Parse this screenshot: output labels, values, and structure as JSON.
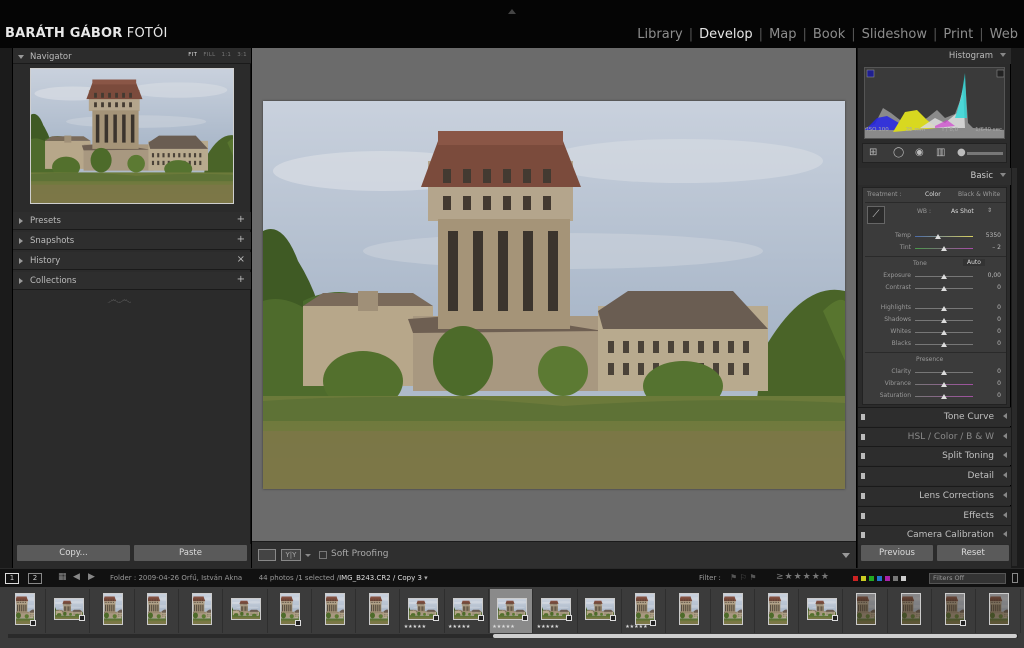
{
  "brand": {
    "bold": "BARÁTH GÁBOR",
    "light": "FOTÓI"
  },
  "modules": [
    {
      "label": "Library",
      "active": false
    },
    {
      "label": "Develop",
      "active": true
    },
    {
      "label": "Map",
      "active": false
    },
    {
      "label": "Book",
      "active": false
    },
    {
      "label": "Slideshow",
      "active": false
    },
    {
      "label": "Print",
      "active": false
    },
    {
      "label": "Web",
      "active": false
    }
  ],
  "left": {
    "navigator": {
      "label": "Navigator",
      "opts": [
        "FIT",
        "FILL",
        "1:1",
        "3:1"
      ]
    },
    "panels": [
      {
        "label": "Presets",
        "action": "+"
      },
      {
        "label": "Snapshots",
        "action": "+"
      },
      {
        "label": "History",
        "action": "×"
      },
      {
        "label": "Collections",
        "action": "+"
      }
    ],
    "copy_label": "Copy...",
    "paste_label": "Paste"
  },
  "toolbar": {
    "view_icon_a": "loupe-view-icon",
    "view_icon_b": "Y|Y",
    "soft_proofing": "Soft Proofing"
  },
  "right": {
    "histogram": {
      "label": "Histogram",
      "iso": "ISO 100",
      "focal": "25 mm",
      "aperture": "f / 8,0",
      "shutter": "1/640 sec"
    },
    "basic": {
      "label": "Basic",
      "treatment_label": "Treatment :",
      "treatment_color": "Color",
      "treatment_bw": "Black & White",
      "wb_label": "WB :",
      "wb_value": "As Shot",
      "temp": {
        "label": "Temp",
        "value": "5350"
      },
      "tint": {
        "label": "Tint",
        "value": "– 2"
      },
      "tone_label": "Tone",
      "auto_label": "Auto",
      "tone": [
        {
          "label": "Exposure",
          "value": "0,00"
        },
        {
          "label": "Contrast",
          "value": "0"
        },
        {
          "label": "Highlights",
          "value": "0"
        },
        {
          "label": "Shadows",
          "value": "0"
        },
        {
          "label": "Whites",
          "value": "0"
        },
        {
          "label": "Blacks",
          "value": "0"
        }
      ],
      "presence_label": "Presence",
      "presence": [
        {
          "label": "Clarity",
          "value": "0"
        },
        {
          "label": "Vibrance",
          "value": "0"
        },
        {
          "label": "Saturation",
          "value": "0"
        }
      ]
    },
    "sections": [
      {
        "label": "Tone Curve"
      },
      {
        "label": "HSL  /  Color  /  B & W"
      },
      {
        "label": "Split Toning"
      },
      {
        "label": "Detail"
      },
      {
        "label": "Lens Corrections"
      },
      {
        "label": "Effects"
      },
      {
        "label": "Camera Calibration"
      }
    ],
    "previous_label": "Previous",
    "reset_label": "Reset"
  },
  "filmbar": {
    "page1": "1",
    "page2": "2",
    "folder": "Folder : 2009-04-26 Orfű, István Akna",
    "count": "44 photos /1 selected /",
    "filename": "IMG_B243.CR2 / Copy 3",
    "filter_label": "Filter :",
    "filters_off": "Filters Off",
    "color_labels": [
      "#c22",
      "#cc2",
      "#2a2",
      "#27c",
      "#a2a",
      "#777",
      "#ccc"
    ]
  },
  "filmstrip": {
    "thumbs": [
      {
        "kind": "portrait",
        "badge": true,
        "stars": ""
      },
      {
        "kind": "landscape",
        "badge": true,
        "stars": ""
      },
      {
        "kind": "portrait",
        "badge": false,
        "stars": ""
      },
      {
        "kind": "portrait",
        "badge": false,
        "stars": ""
      },
      {
        "kind": "portrait",
        "badge": false,
        "stars": ""
      },
      {
        "kind": "landscape",
        "badge": false,
        "stars": ""
      },
      {
        "kind": "portrait",
        "badge": true,
        "stars": ""
      },
      {
        "kind": "portrait",
        "badge": false,
        "stars": ""
      },
      {
        "kind": "portrait",
        "badge": false,
        "stars": ""
      },
      {
        "kind": "landscape",
        "badge": true,
        "stars": "★★★★★"
      },
      {
        "kind": "landscape",
        "badge": true,
        "stars": "★★★★★"
      },
      {
        "kind": "landscape",
        "badge": true,
        "stars": "★★★★★",
        "selected": true
      },
      {
        "kind": "landscape",
        "badge": true,
        "stars": "★★★★★"
      },
      {
        "kind": "landscape",
        "badge": true,
        "stars": ""
      },
      {
        "kind": "portrait",
        "badge": true,
        "stars": "★★★★★"
      },
      {
        "kind": "portrait",
        "badge": false,
        "stars": ""
      },
      {
        "kind": "portrait",
        "badge": false,
        "stars": ""
      },
      {
        "kind": "portrait",
        "badge": false,
        "stars": ""
      },
      {
        "kind": "landscape",
        "badge": true,
        "stars": ""
      },
      {
        "kind": "portrait-dark",
        "badge": false,
        "stars": ""
      },
      {
        "kind": "portrait-dark",
        "badge": false,
        "stars": ""
      },
      {
        "kind": "portrait-dark",
        "badge": true,
        "stars": ""
      },
      {
        "kind": "portrait-dark",
        "badge": false,
        "stars": ""
      }
    ]
  }
}
